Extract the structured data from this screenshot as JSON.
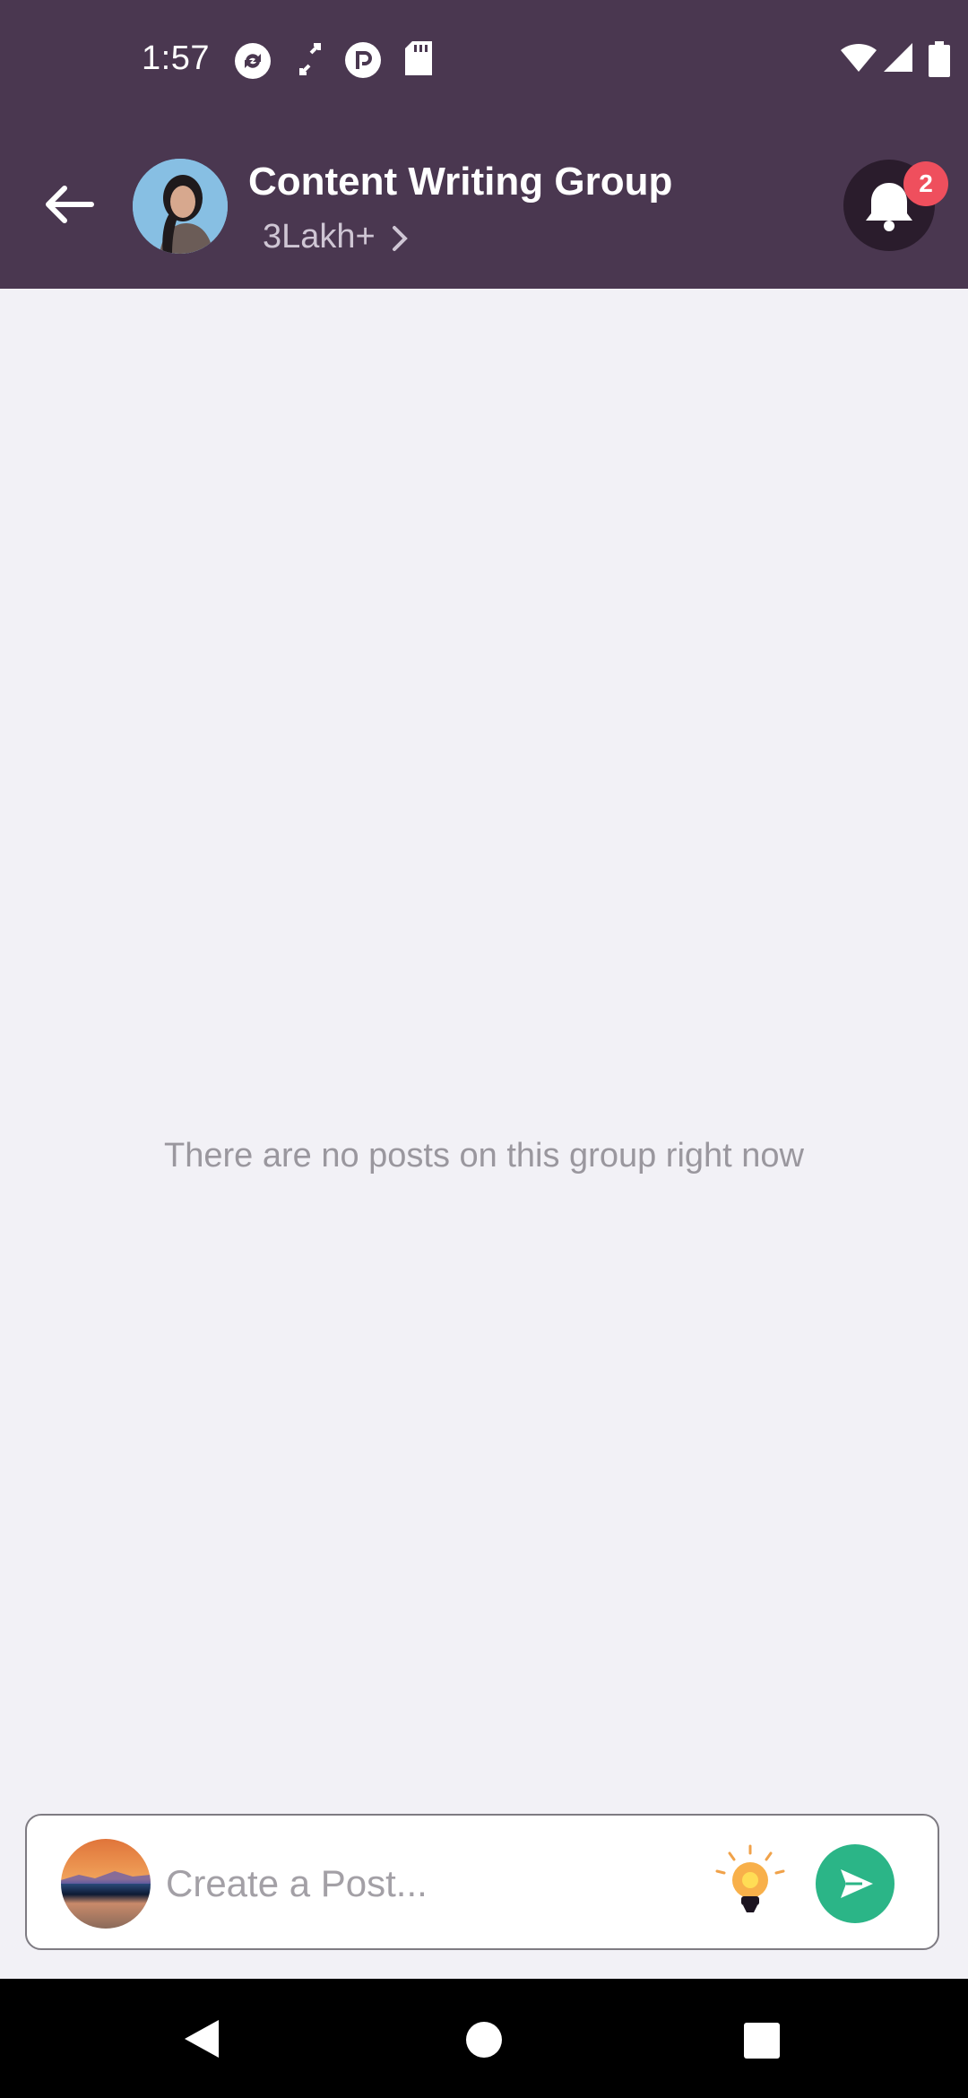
{
  "status_bar": {
    "time": "1:57",
    "left_icons": [
      "sync-icon",
      "link-icon",
      "pocketcasts-icon",
      "sd-card-icon"
    ],
    "right_icons": [
      "wifi-icon",
      "signal-icon",
      "battery-icon"
    ]
  },
  "header": {
    "back_icon": "arrow-left-icon",
    "title": "Content Writing Group",
    "members": "3Lakh+",
    "notifications": {
      "icon": "bell-icon",
      "badge": "2"
    }
  },
  "main": {
    "empty_message": "There are no posts on this group right now"
  },
  "composer": {
    "placeholder": "Create a Post...",
    "tip_icon": "lightbulb-icon",
    "send_icon": "send-icon"
  },
  "colors": {
    "header_bg": "#4a3750",
    "page_bg": "#f2f1f6",
    "badge": "#ef4f5d",
    "send": "#2bb587"
  }
}
